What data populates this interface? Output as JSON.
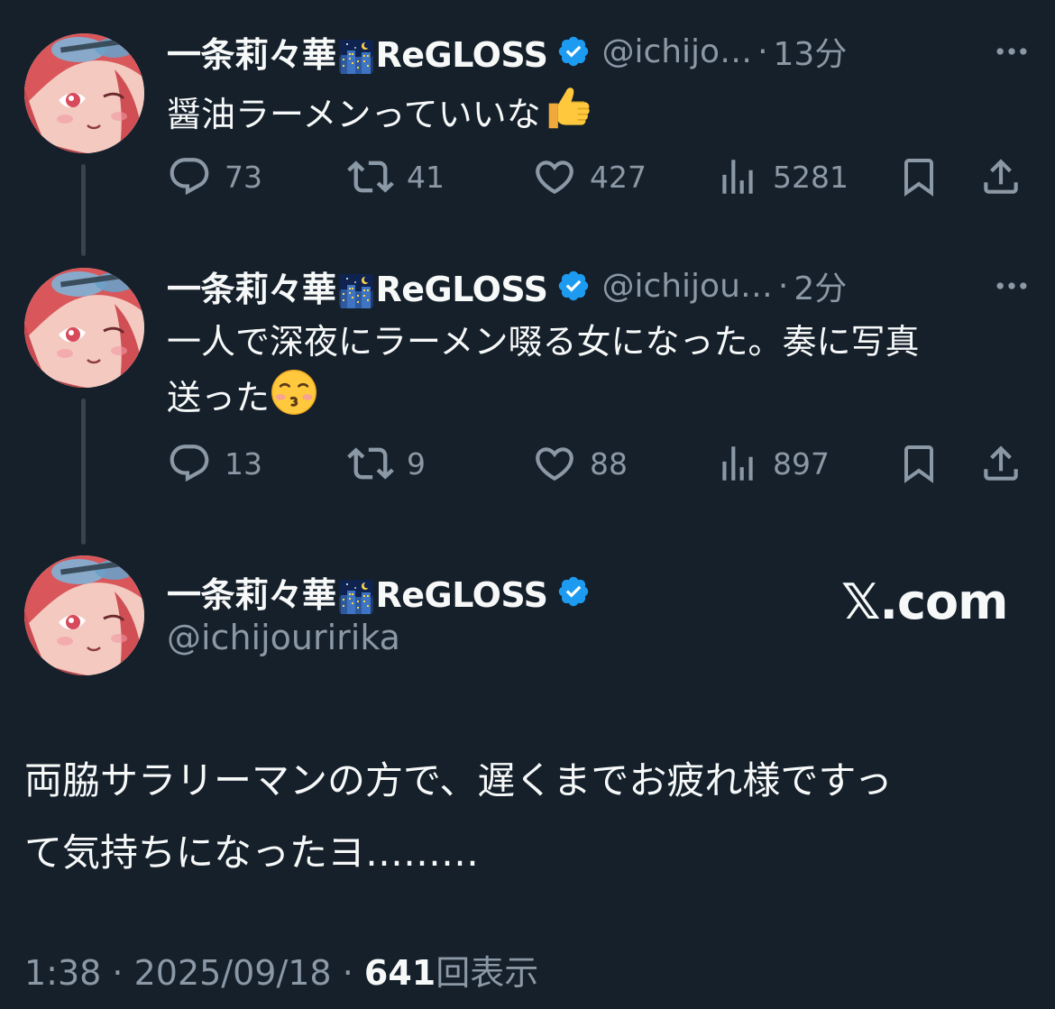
{
  "colors": {
    "background": "#15202b",
    "text_primary": "#f7f9f9",
    "text_secondary": "#8b98a5",
    "verified": "#1d9bf0",
    "thread_line": "#38444d"
  },
  "icons": {
    "verified": "verified-badge-icon",
    "city_night": "night-city-emoji-icon",
    "thumbs_up": "thumbs-up-emoji-icon",
    "kiss": "kissing-face-emoji-icon",
    "reply": "reply-icon",
    "retweet": "retweet-icon",
    "like": "heart-icon",
    "views": "analytics-icon",
    "bookmark": "bookmark-icon",
    "share": "share-icon",
    "more": "more-dots-icon"
  },
  "tweets": [
    {
      "name_prefix": "一条莉々華",
      "name_suffix": "ReGLOSS",
      "handle": "@ichijo…",
      "separator": "·",
      "time": "13分",
      "text": "醤油ラーメンっていいな",
      "stats": {
        "replies": "73",
        "retweets": "41",
        "likes": "427",
        "views": "5281"
      }
    },
    {
      "name_prefix": "一条莉々華",
      "name_suffix": "ReGLOSS",
      "handle": "@ichijou…",
      "separator": "·",
      "time": "2分",
      "text_line1": "一人で深夜にラーメン啜る女になった。奏に写真",
      "text_line2": "送った",
      "stats": {
        "replies": "13",
        "retweets": "9",
        "likes": "88",
        "views": "897"
      }
    }
  ],
  "main_tweet": {
    "name_prefix": "一条莉々華",
    "name_suffix": "ReGLOSS",
    "handle": "@ichijouririka",
    "brand": "𝕏.com",
    "text_line1": "両脇サラリーマンの方で、遅くまでお疲れ様ですっ",
    "text_line2": "て気持ちになったヨ………",
    "meta_time": "1:38",
    "meta_sep1": " · ",
    "meta_date": "2025/09/18",
    "meta_sep2": " · ",
    "meta_views": "641",
    "meta_views_label": "回表示"
  }
}
